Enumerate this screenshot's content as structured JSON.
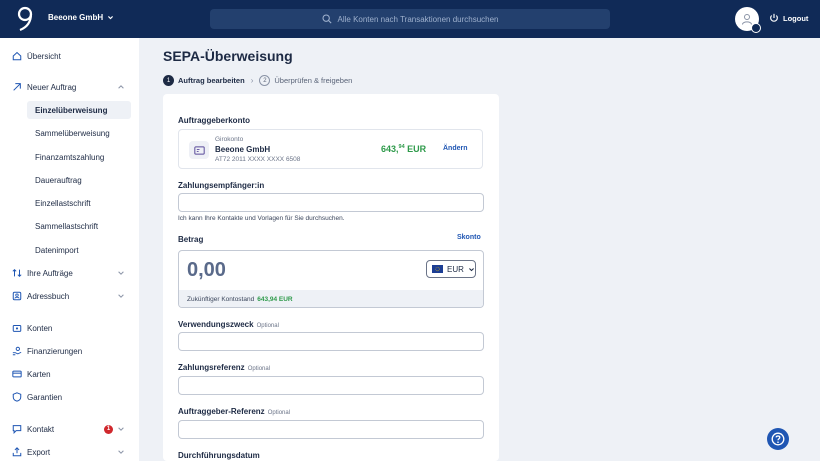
{
  "header": {
    "company": "Beeone GmbH",
    "search_placeholder": "Alle Konten nach Transaktionen durchsuchen",
    "logout": "Logout"
  },
  "sidebar": {
    "overview": "Übersicht",
    "new_order": "Neuer Auftrag",
    "sub_items": [
      "Einzelüberweisung",
      "Sammelüberweisung",
      "Finanzamtszahlung",
      "Dauerauftrag",
      "Einzellastschrift",
      "Sammellastschrift",
      "Datenimport"
    ],
    "your_orders": "Ihre Aufträge",
    "address_book": "Adressbuch",
    "accounts": "Konten",
    "financing": "Finanzierungen",
    "cards": "Karten",
    "guarantees": "Garantien",
    "contact": "Kontakt",
    "contact_badge": "1",
    "export": "Export"
  },
  "page": {
    "title": "SEPA-Überweisung",
    "steps": [
      {
        "num": "1",
        "label": "Auftrag bearbeiten"
      },
      {
        "num": "2",
        "label": "Überprüfen & freigeben"
      }
    ]
  },
  "form": {
    "payer_label": "Auftraggeberkonto",
    "account_type": "Girokonto",
    "account_name": "Beeone GmbH",
    "account_iban": "AT72 2011 XXXX XXXX 6508",
    "balance_main": "643,",
    "balance_cents": "94",
    "balance_currency": " EUR",
    "change": "Ändern",
    "recipient_label": "Zahlungsempfänger:in",
    "recipient_hint": "Ich kann Ihre Kontakte und Vorlagen für Sie durchsuchen.",
    "amount_label": "Betrag",
    "skonto": "Skonto",
    "amount_value": "0,00",
    "currency": "EUR",
    "future_balance_label": "Zukünftiger Kontostand",
    "future_balance_value": "643,94 EUR",
    "purpose_label": "Verwendungszweck",
    "optional": "Optional",
    "reference_label": "Zahlungsreferenz",
    "payer_reference_label": "Auftraggeber-Referenz",
    "date_label": "Durchführungsdatum"
  }
}
